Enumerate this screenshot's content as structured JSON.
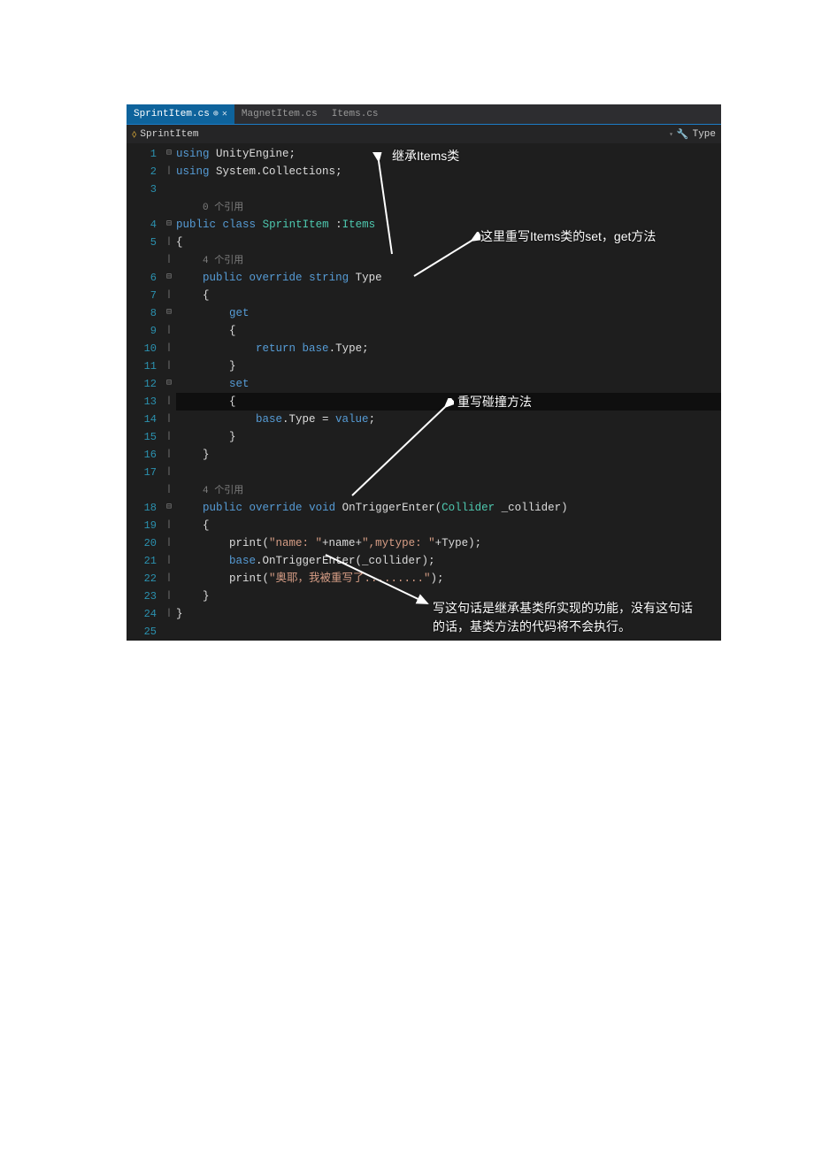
{
  "tabs": [
    {
      "label": "SprintItem.cs",
      "active": true,
      "pinned": true,
      "closeable": true
    },
    {
      "label": "MagnetItem.cs",
      "active": false
    },
    {
      "label": "Items.cs",
      "active": false
    }
  ],
  "nav": {
    "class_name": "SprintItem",
    "member_name": "Type"
  },
  "refs_label": "个引用",
  "refs_count_0": "0",
  "refs_count_4a": "4",
  "refs_count_4b": "4",
  "code_lines": [
    {
      "n": 1,
      "fold": "⊟",
      "tokens": [
        [
          "kw",
          "using"
        ],
        [
          "punc",
          " "
        ],
        [
          "ident",
          "UnityEngine"
        ],
        [
          "punc",
          ";"
        ]
      ]
    },
    {
      "n": 2,
      "fold": "|",
      "tokens": [
        [
          "kw",
          "using"
        ],
        [
          "punc",
          " "
        ],
        [
          "ident",
          "System.Collections"
        ],
        [
          "punc",
          ";"
        ]
      ]
    },
    {
      "n": 3,
      "fold": "",
      "tokens": []
    },
    {
      "n": null,
      "fold": "",
      "ref": "0"
    },
    {
      "n": 4,
      "fold": "⊟",
      "tokens": [
        [
          "kw",
          "public"
        ],
        [
          "punc",
          " "
        ],
        [
          "kw",
          "class"
        ],
        [
          "punc",
          " "
        ],
        [
          "type",
          "SprintItem"
        ],
        [
          "punc",
          " :"
        ],
        [
          "type",
          "Items"
        ]
      ]
    },
    {
      "n": 5,
      "fold": "|",
      "tokens": [
        [
          "punc",
          "{"
        ]
      ]
    },
    {
      "n": null,
      "fold": "|",
      "ref": "4a"
    },
    {
      "n": 6,
      "fold": "⊟",
      "indent": "    ",
      "tokens": [
        [
          "kw",
          "public"
        ],
        [
          "punc",
          " "
        ],
        [
          "kw",
          "override"
        ],
        [
          "punc",
          " "
        ],
        [
          "kw",
          "string"
        ],
        [
          "punc",
          " "
        ],
        [
          "ident",
          "Type"
        ]
      ]
    },
    {
      "n": 7,
      "fold": "|",
      "indent": "    ",
      "tokens": [
        [
          "punc",
          "{"
        ]
      ]
    },
    {
      "n": 8,
      "fold": "⊟",
      "indent": "        ",
      "tokens": [
        [
          "kw",
          "get"
        ]
      ]
    },
    {
      "n": 9,
      "fold": "|",
      "indent": "        ",
      "tokens": [
        [
          "punc",
          "{"
        ]
      ]
    },
    {
      "n": 10,
      "fold": "|",
      "indent": "            ",
      "tokens": [
        [
          "kw",
          "return"
        ],
        [
          "punc",
          " "
        ],
        [
          "kw",
          "base"
        ],
        [
          "punc",
          ".Type;"
        ]
      ]
    },
    {
      "n": 11,
      "fold": "|",
      "indent": "        ",
      "tokens": [
        [
          "punc",
          "}"
        ]
      ]
    },
    {
      "n": 12,
      "fold": "⊟",
      "indent": "        ",
      "tokens": [
        [
          "kw",
          "set"
        ]
      ]
    },
    {
      "n": 13,
      "fold": "|",
      "indent": "        ",
      "highlight": true,
      "tokens": [
        [
          "punc",
          "{"
        ]
      ]
    },
    {
      "n": 14,
      "fold": "|",
      "indent": "            ",
      "tokens": [
        [
          "kw",
          "base"
        ],
        [
          "punc",
          ".Type = "
        ],
        [
          "kw",
          "value"
        ],
        [
          "punc",
          ";"
        ]
      ]
    },
    {
      "n": 15,
      "fold": "|",
      "indent": "        ",
      "tokens": [
        [
          "punc",
          "}"
        ]
      ]
    },
    {
      "n": 16,
      "fold": "|",
      "indent": "    ",
      "tokens": [
        [
          "punc",
          "}"
        ]
      ]
    },
    {
      "n": 17,
      "fold": "|",
      "tokens": []
    },
    {
      "n": null,
      "fold": "|",
      "ref": "4b"
    },
    {
      "n": 18,
      "fold": "⊟",
      "indent": "    ",
      "tokens": [
        [
          "kw",
          "public"
        ],
        [
          "punc",
          " "
        ],
        [
          "kw",
          "override"
        ],
        [
          "punc",
          " "
        ],
        [
          "kw",
          "void"
        ],
        [
          "punc",
          " "
        ],
        [
          "ident",
          "OnTriggerEnter("
        ],
        [
          "type",
          "Collider"
        ],
        [
          "punc",
          " _collider)"
        ]
      ]
    },
    {
      "n": 19,
      "fold": "|",
      "indent": "    ",
      "tokens": [
        [
          "punc",
          "{"
        ]
      ]
    },
    {
      "n": 20,
      "fold": "|",
      "indent": "        ",
      "tokens": [
        [
          "ident",
          "print("
        ],
        [
          "str",
          "\"name: \""
        ],
        [
          "punc",
          "+name+"
        ],
        [
          "str",
          "\",mytype: \""
        ],
        [
          "punc",
          "+Type);"
        ]
      ]
    },
    {
      "n": 21,
      "fold": "|",
      "indent": "        ",
      "tokens": [
        [
          "kw",
          "base"
        ],
        [
          "punc",
          ".OnTriggerEnter(_collider);"
        ]
      ]
    },
    {
      "n": 22,
      "fold": "|",
      "indent": "        ",
      "tokens": [
        [
          "ident",
          "print("
        ],
        [
          "str",
          "\"奥耶，我被重写了.........\""
        ],
        [
          "punc",
          ");"
        ]
      ]
    },
    {
      "n": 23,
      "fold": "|",
      "indent": "    ",
      "tokens": [
        [
          "punc",
          "}"
        ]
      ]
    },
    {
      "n": 24,
      "fold": "|",
      "tokens": [
        [
          "punc",
          "}"
        ]
      ]
    },
    {
      "n": 25,
      "fold": "",
      "tokens": []
    }
  ],
  "annotations": {
    "a1": "继承Items类",
    "a2": "这里重写Items类的set，get方法",
    "a3": "重写碰撞方法",
    "a4": "写这句话是继承基类所实现的功能，没有这句话的话，基类方法的代码将不会执行。"
  }
}
